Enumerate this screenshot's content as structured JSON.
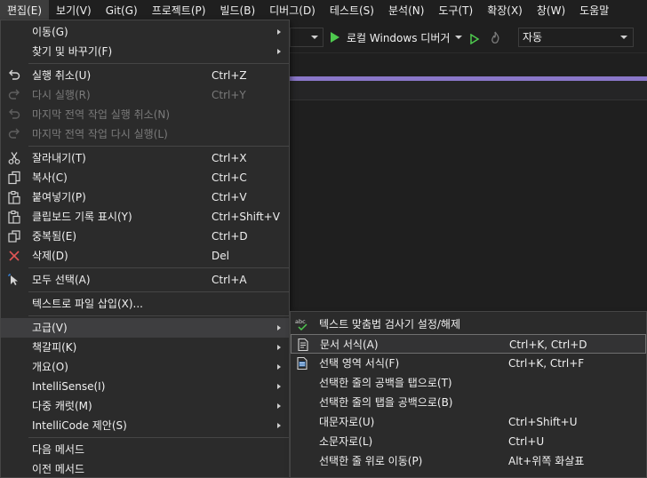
{
  "menubar": [
    {
      "label": "편집(E)",
      "active": true
    },
    {
      "label": "보기(V)"
    },
    {
      "label": "Git(G)"
    },
    {
      "label": "프로젝트(P)"
    },
    {
      "label": "빌드(B)"
    },
    {
      "label": "디버그(D)"
    },
    {
      "label": "테스트(S)"
    },
    {
      "label": "분석(N)"
    },
    {
      "label": "도구(T)"
    },
    {
      "label": "확장(X)"
    },
    {
      "label": "창(W)"
    },
    {
      "label": "도움말"
    }
  ],
  "toolbar": {
    "run_label": "로컬 Windows 디버거",
    "mode_value": "자동"
  },
  "edit_menu": {
    "goto": "이동(G)",
    "find_replace": "찾기 및 바꾸기(F)",
    "undo": {
      "label": "실행 취소(U)",
      "shortcut": "Ctrl+Z"
    },
    "redo": {
      "label": "다시 실행(R)",
      "shortcut": "Ctrl+Y"
    },
    "undo_last_global": "마지막 전역 작업 실행 취소(N)",
    "redo_last_global": "마지막 전역 작업 다시 실행(L)",
    "cut": {
      "label": "잘라내기(T)",
      "shortcut": "Ctrl+X"
    },
    "copy": {
      "label": "복사(C)",
      "shortcut": "Ctrl+C"
    },
    "paste": {
      "label": "붙여넣기(P)",
      "shortcut": "Ctrl+V"
    },
    "clipboard_history": {
      "label": "클립보드 기록 표시(Y)",
      "shortcut": "Ctrl+Shift+V"
    },
    "duplicate": {
      "label": "중복됨(E)",
      "shortcut": "Ctrl+D"
    },
    "delete": {
      "label": "삭제(D)",
      "shortcut": "Del"
    },
    "select_all": {
      "label": "모두 선택(A)",
      "shortcut": "Ctrl+A"
    },
    "insert_file_as_text": "텍스트로 파일 삽입(X)...",
    "advanced": "고급(V)",
    "bookmarks": "책갈피(K)",
    "outlining": "개요(O)",
    "intellisense": "IntelliSense(I)",
    "multi_caret": "다중 캐럿(M)",
    "intellicode": "IntelliCode 제안(S)",
    "next_method": "다음 메서드",
    "previous_method": "이전 메서드"
  },
  "advanced_menu": {
    "spell_checker": "텍스트 맞춤법 검사기 설정/해제",
    "format_document": {
      "label": "문서 서식(A)",
      "shortcut": "Ctrl+K, Ctrl+D"
    },
    "format_selection": {
      "label": "선택 영역 서식(F)",
      "shortcut": "Ctrl+K, Ctrl+F"
    },
    "tabify": "선택한 줄의 공백을 탭으로(T)",
    "untabify": "선택한 줄의 탭을 공백으로(B)",
    "uppercase": {
      "label": "대문자로(U)",
      "shortcut": "Ctrl+Shift+U"
    },
    "lowercase": {
      "label": "소문자로(L)",
      "shortcut": "Ctrl+U"
    },
    "move_line_up": {
      "label": "선택한 줄 위로 이동(P)",
      "shortcut": "Alt+위쪽 화살표"
    }
  }
}
